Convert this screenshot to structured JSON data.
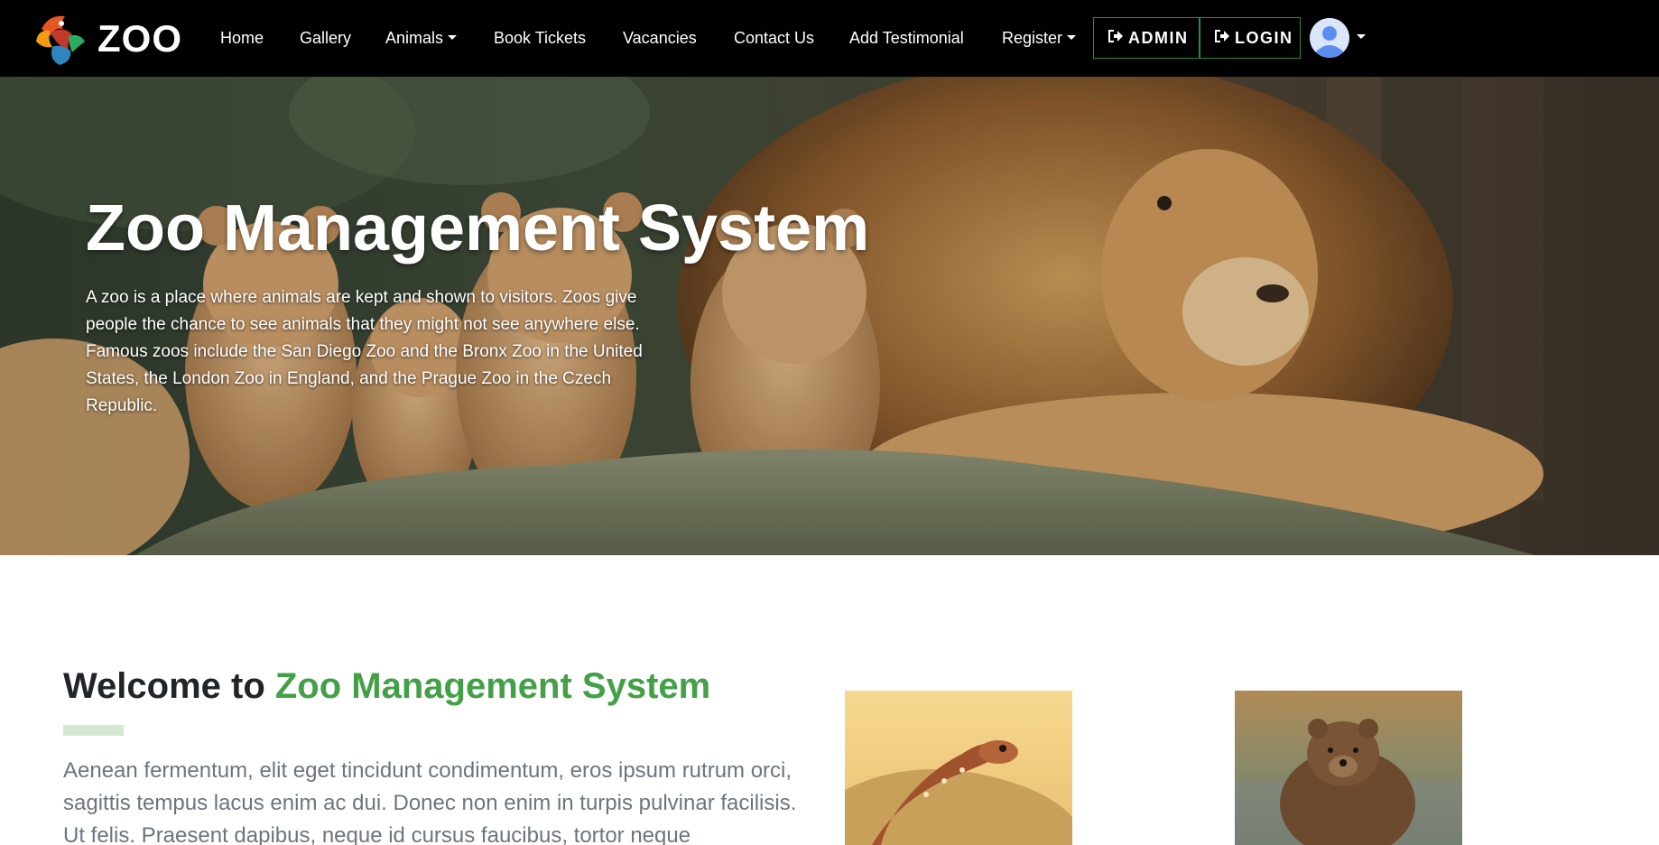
{
  "brand": {
    "name": "ZOO",
    "logo_icon": "zoo-logo-icon"
  },
  "nav": {
    "home": "Home",
    "gallery": "Gallery",
    "animals": "Animals",
    "book_tickets": "Book Tickets",
    "vacancies": "Vacancies",
    "contact_us": "Contact Us",
    "add_testimonial": "Add Testimonial",
    "register": "Register",
    "admin_button": "ADMIN",
    "login_button": "LOGIN",
    "button_icon": "sign-in-icon",
    "avatar_icon": "user-avatar-icon"
  },
  "hero": {
    "title": "Zoo Management System",
    "text": "A zoo is a place where animals are kept and shown to visitors. Zoos give people the chance to see animals that they might not see anywhere else. Famous zoos include the San Diego Zoo and the Bronx Zoo in the United States, the London Zoo in England, and the Prague Zoo in the Czech Republic."
  },
  "welcome": {
    "title_prefix": "Welcome to ",
    "title_highlight": "Zoo Management System",
    "text": "Aenean fermentum, elit eget tincidunt condimentum, eros ipsum rutrum orci, sagittis tempus lacus enim ac dui. Donec non enim in turpis pulvinar facilisis. Ut felis. Praesent dapibus, neque id cursus faucibus, tortor neque"
  },
  "colors": {
    "navbar_bg": "#000000",
    "accent_green": "#43a047",
    "button_border": "#2e8b3a",
    "underline": "#d3e8cf",
    "body_text": "#6c757d",
    "heading_text": "#212529"
  }
}
